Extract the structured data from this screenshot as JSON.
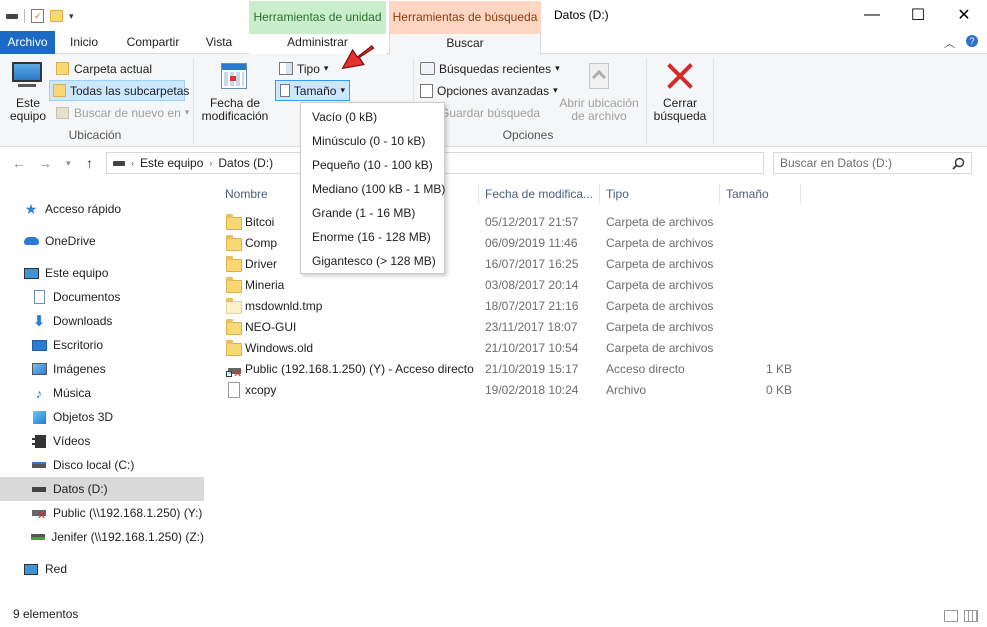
{
  "window": {
    "title": "Datos (D:)",
    "minimize": "—",
    "maximize": "☐",
    "close": "✕"
  },
  "context_tabs": {
    "unit_tools": "Herramientas de unidad",
    "search_tools": "Herramientas de búsqueda"
  },
  "tabs": {
    "archivo": "Archivo",
    "inicio": "Inicio",
    "compartir": "Compartir",
    "vista": "Vista",
    "administrar": "Administrar",
    "buscar": "Buscar"
  },
  "ribbon": {
    "ubicacion": {
      "este_equipo_1": "Este",
      "este_equipo_2": "equipo",
      "carpeta_actual": "Carpeta actual",
      "todas_subcarpetas": "Todas las subcarpetas",
      "buscar_de_nuevo": "Buscar de nuevo en",
      "label": "Ubicación"
    },
    "refinar": {
      "fecha_1": "Fecha de",
      "fecha_2": "modificación",
      "tipo": "Tipo",
      "tamano": "Tamaño"
    },
    "opciones": {
      "busquedas_recientes": "Búsquedas recientes",
      "opciones_avanzadas": "Opciones avanzadas",
      "guardar_busqueda": "Guardar búsqueda",
      "abrir_ubicacion_1": "Abrir ubicación",
      "abrir_ubicacion_2": "de archivo",
      "label": "Opciones"
    },
    "cerrar": {
      "line1": "Cerrar",
      "line2": "búsqueda"
    }
  },
  "size_dropdown": [
    "Vacío (0 kB)",
    "Minúsculo (0 - 10 kB)",
    "Pequeño (10 - 100 kB)",
    "Mediano (100 kB - 1 MB)",
    "Grande (1 - 16 MB)",
    "Enorme (16 - 128 MB)",
    "Gigantesco (> 128 MB)"
  ],
  "address": {
    "crumb1": "Este equipo",
    "crumb2": "Datos (D:)",
    "search_placeholder": "Buscar en Datos (D:)"
  },
  "sidebar": [
    {
      "label": "Acceso rápido",
      "icon": "star-icon"
    },
    {
      "label": "OneDrive",
      "icon": "cloud-icon"
    },
    {
      "label": "Este equipo",
      "icon": "computer-icon"
    },
    {
      "label": "Documentos",
      "icon": "documents-icon"
    },
    {
      "label": "Downloads",
      "icon": "download-icon"
    },
    {
      "label": "Escritorio",
      "icon": "desktop-icon"
    },
    {
      "label": "Imágenes",
      "icon": "pictures-icon"
    },
    {
      "label": "Música",
      "icon": "music-icon"
    },
    {
      "label": "Objetos 3D",
      "icon": "objects-3d-icon"
    },
    {
      "label": "Vídeos",
      "icon": "videos-icon"
    },
    {
      "label": "Disco local (C:)",
      "icon": "drive-icon"
    },
    {
      "label": "Datos (D:)",
      "icon": "drive-icon"
    },
    {
      "label": "Public (\\\\192.168.1.250) (Y:)",
      "icon": "network-drive-disconnected-icon"
    },
    {
      "label": "Jenifer (\\\\192.168.1.250) (Z:)",
      "icon": "network-drive-icon"
    },
    {
      "label": "Red",
      "icon": "network-icon"
    }
  ],
  "columns": {
    "name": "Nombre",
    "date": "Fecha de modifica...",
    "type": "Tipo",
    "size": "Tamaño"
  },
  "files": [
    {
      "name": "Bitcoi",
      "date": "05/12/2017 21:57",
      "type": "Carpeta de archivos",
      "size": "",
      "icon": "folder-icon"
    },
    {
      "name": "Comp",
      "date": "06/09/2019 11:46",
      "type": "Carpeta de archivos",
      "size": "",
      "icon": "folder-icon"
    },
    {
      "name": "Driver",
      "date": "16/07/2017 16:25",
      "type": "Carpeta de archivos",
      "size": "",
      "icon": "folder-icon"
    },
    {
      "name": "Mineria",
      "date": "03/08/2017 20:14",
      "type": "Carpeta de archivos",
      "size": "",
      "icon": "folder-icon"
    },
    {
      "name": "msdownld.tmp",
      "date": "18/07/2017 21:16",
      "type": "Carpeta de archivos",
      "size": "",
      "icon": "folder-icon"
    },
    {
      "name": "NEO-GUI",
      "date": "23/11/2017 18:07",
      "type": "Carpeta de archivos",
      "size": "",
      "icon": "folder-icon"
    },
    {
      "name": "Windows.old",
      "date": "21/10/2017 10:54",
      "type": "Carpeta de archivos",
      "size": "",
      "icon": "folder-icon"
    },
    {
      "name": "Public (192.168.1.250) (Y) - Acceso directo",
      "date": "21/10/2019 15:17",
      "type": "Acceso directo",
      "size": "1 KB",
      "icon": "shortcut-icon"
    },
    {
      "name": "xcopy",
      "date": "19/02/2018 10:24",
      "type": "Archivo",
      "size": "0 KB",
      "icon": "file-icon"
    }
  ],
  "status": {
    "count": "9 elementos"
  },
  "colors": {
    "accent": "#1a69c4",
    "selection": "#cce8ff",
    "arrow": "#e03030"
  }
}
